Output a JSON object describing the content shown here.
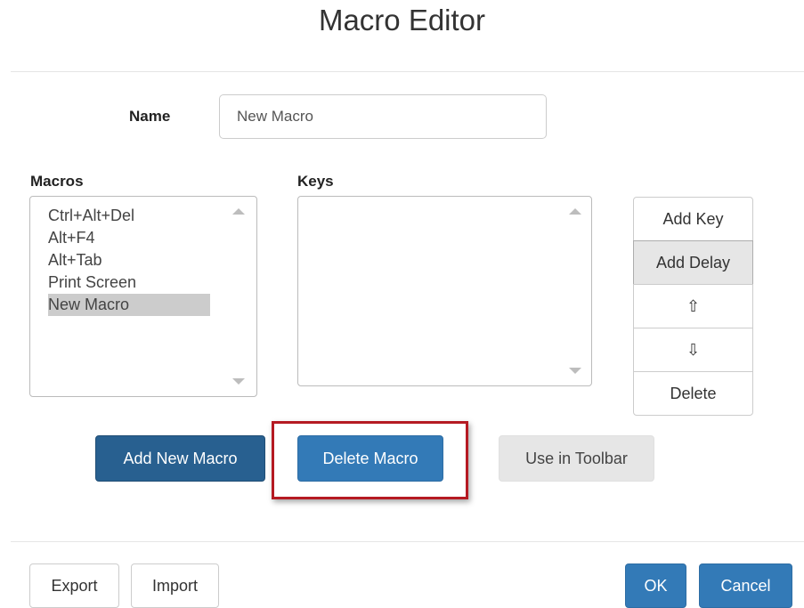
{
  "dialog": {
    "title": "Macro Editor"
  },
  "name_field": {
    "label": "Name",
    "value": "New Macro"
  },
  "macros": {
    "label": "Macros",
    "items": [
      "Ctrl+Alt+Del",
      "Alt+F4",
      "Alt+Tab",
      "Print Screen",
      "New Macro"
    ],
    "selected": "New Macro"
  },
  "keys": {
    "label": "Keys",
    "items": []
  },
  "key_buttons": {
    "add_key": "Add Key",
    "add_delay": "Add Delay",
    "move_up": "⇧",
    "move_down": "⇩",
    "delete": "Delete"
  },
  "macro_buttons": {
    "add_new_macro": "Add New Macro",
    "delete_macro": "Delete Macro",
    "use_in_toolbar": "Use in Toolbar"
  },
  "footer": {
    "export": "Export",
    "import": "Import",
    "ok": "OK",
    "cancel": "Cancel"
  },
  "colors": {
    "primary": "#337ab7",
    "primary_dark": "#286090",
    "highlight_border": "#b51a22"
  }
}
